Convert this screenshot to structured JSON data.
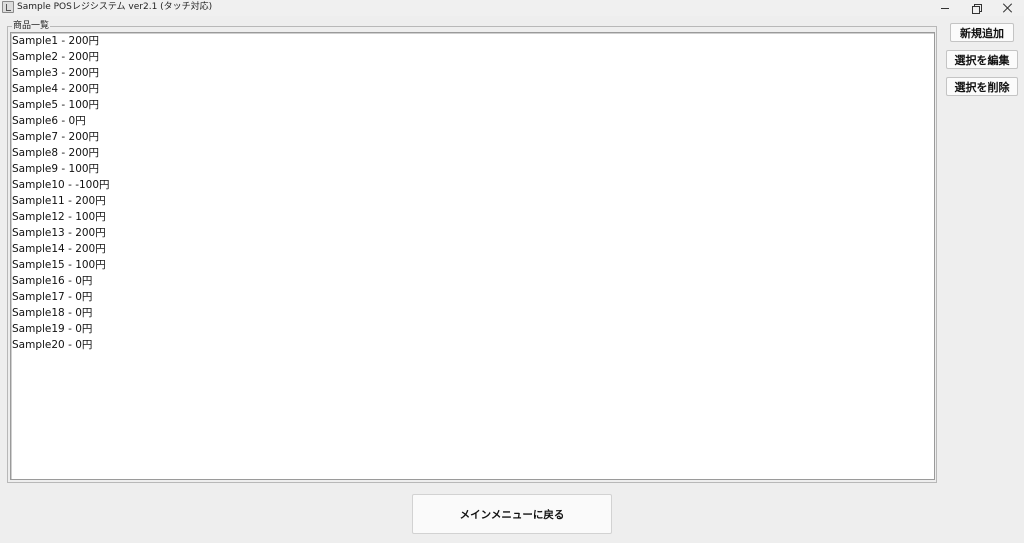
{
  "window": {
    "title": "Sample POSレジシステム ver2.1 (タッチ対応)"
  },
  "group": {
    "label": "商品一覧"
  },
  "products": [
    "Sample1 - 200円",
    "Sample2 - 200円",
    "Sample3 - 200円",
    "Sample4 - 200円",
    "Sample5 - 100円",
    "Sample6 - 0円",
    "Sample7 - 200円",
    "Sample8 - 200円",
    "Sample9 - 100円",
    "Sample10 - -100円",
    "Sample11 - 200円",
    "Sample12 - 100円",
    "Sample13 - 200円",
    "Sample14 - 200円",
    "Sample15 - 100円",
    "Sample16 - 0円",
    "Sample17 - 0円",
    "Sample18 - 0円",
    "Sample19 - 0円",
    "Sample20 - 0円"
  ],
  "actions": {
    "add_label": "新規追加",
    "edit_label": "選択を編集",
    "delete_label": "選択を削除",
    "back_label": "メインメニューに戻る"
  }
}
